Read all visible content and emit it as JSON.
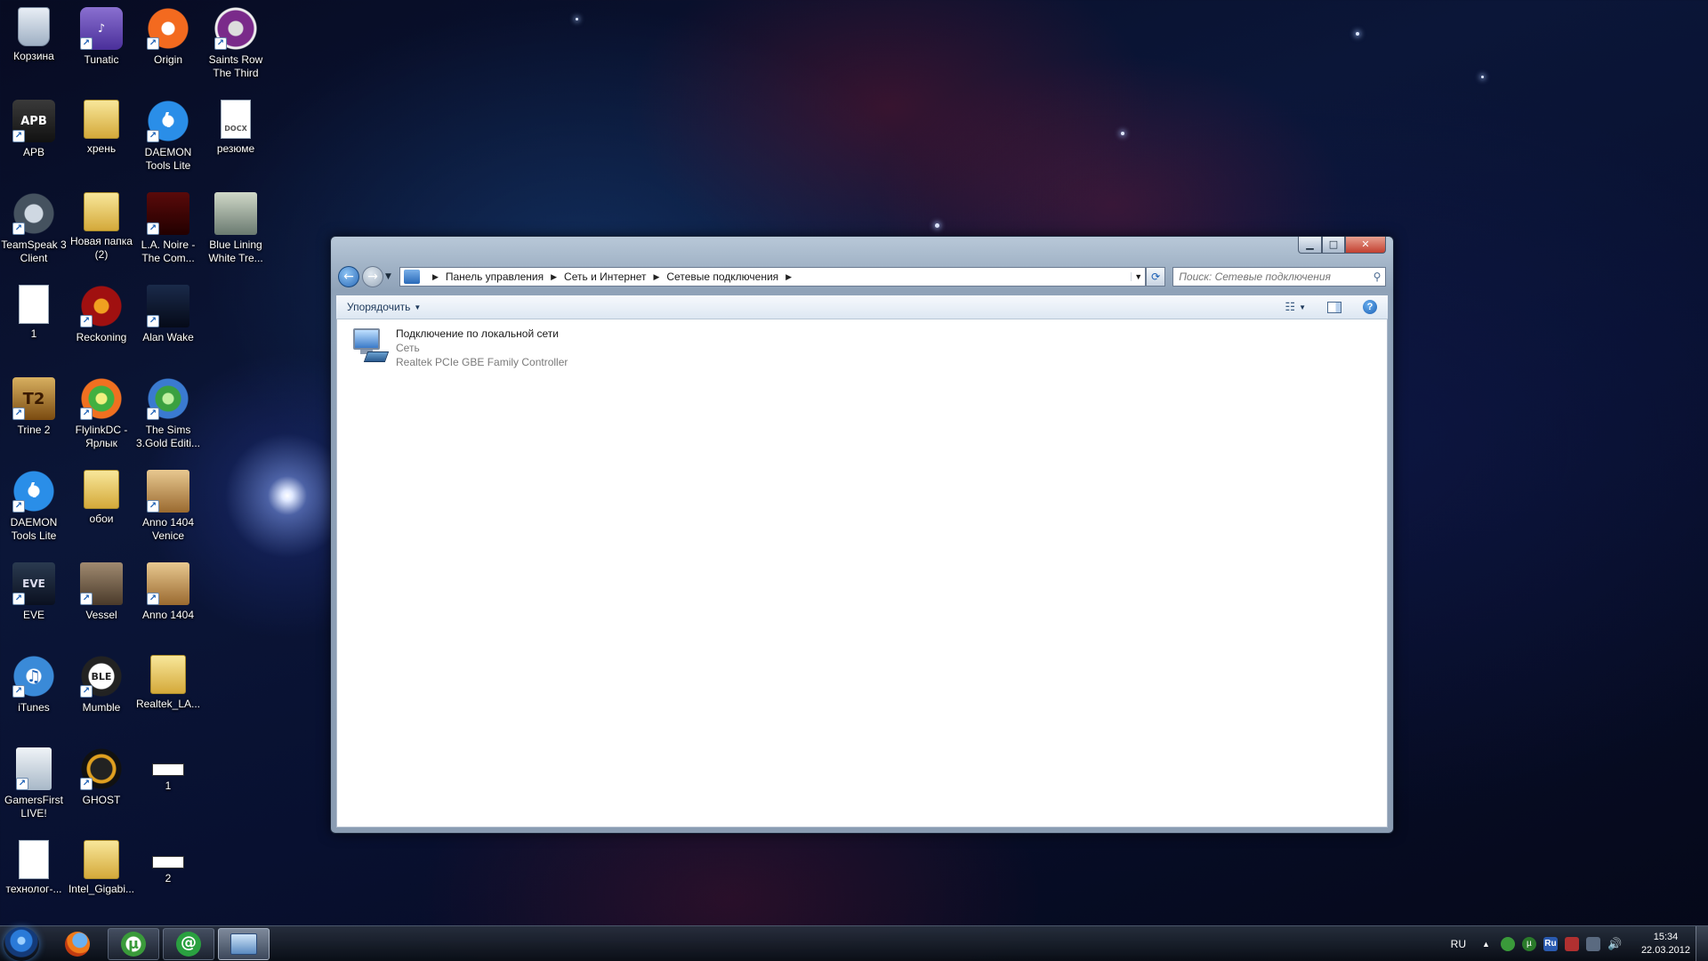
{
  "desktop": {
    "icons": [
      {
        "label": "Корзина",
        "icon": "recycle-bin-icon"
      },
      {
        "label": "Tunatic",
        "icon": "tunatic-icon"
      },
      {
        "label": "Origin",
        "icon": "origin-icon"
      },
      {
        "label": "Saints Row The Third",
        "icon": "saints-row-icon"
      },
      {
        "label": "APB",
        "icon": "apb-icon"
      },
      {
        "label": "хрень",
        "icon": "folder-icon"
      },
      {
        "label": "DAEMON Tools Lite",
        "icon": "daemon-tools-icon"
      },
      {
        "label": "резюме",
        "icon": "docx-file-icon",
        "badge": "DOCX"
      },
      {
        "label": "TeamSpeak 3 Client",
        "icon": "teamspeak-icon"
      },
      {
        "label": "Новая папка (2)",
        "icon": "folder-icon"
      },
      {
        "label": "L.A. Noire - The Com...",
        "icon": "la-noire-icon"
      },
      {
        "label": "Blue Lining White Tre...",
        "icon": "blue-lining-icon"
      },
      {
        "label": "1",
        "icon": "text-file-icon"
      },
      {
        "label": "Reckoning",
        "icon": "reckoning-icon"
      },
      {
        "label": "Alan Wake",
        "icon": "alan-wake-icon"
      },
      {
        "label": "Trine 2",
        "icon": "trine-icon"
      },
      {
        "label": "FlylinkDC - Ярлык",
        "icon": "flylinkdc-icon"
      },
      {
        "label": "The Sims 3.Gold Editi...",
        "icon": "sims-icon"
      },
      {
        "label": "DAEMON Tools Lite",
        "icon": "daemon-tools-icon"
      },
      {
        "label": "обои",
        "icon": "folder-icon"
      },
      {
        "label": "Anno 1404 Venice",
        "icon": "anno-icon"
      },
      {
        "label": "EVE",
        "icon": "eve-icon"
      },
      {
        "label": "Vessel",
        "icon": "vessel-icon"
      },
      {
        "label": "Anno 1404",
        "icon": "anno-icon"
      },
      {
        "label": "iTunes",
        "icon": "itunes-icon"
      },
      {
        "label": "Mumble",
        "icon": "mumble-icon"
      },
      {
        "label": "Realtek_LA...",
        "icon": "folder-icon"
      },
      {
        "label": "GamersFirst LIVE!",
        "icon": "gamersfirst-icon"
      },
      {
        "label": "GHOST",
        "icon": "ghost-icon"
      },
      {
        "label": "1",
        "icon": "shortcut-file-icon"
      },
      {
        "label": "технолог-...",
        "icon": "text-file-icon"
      },
      {
        "label": "Intel_Gigabi...",
        "icon": "folder-icon"
      },
      {
        "label": "2",
        "icon": "shortcut-file-icon"
      }
    ]
  },
  "window": {
    "controls": {
      "minimize": "▁",
      "maximize": "□",
      "close": "✕"
    },
    "breadcrumb": [
      "Панель управления",
      "Сеть и Интернет",
      "Сетевые подключения"
    ],
    "search_placeholder": "Поиск: Сетевые подключения",
    "toolbar": {
      "organize_label": "Упорядочить",
      "help": "?"
    },
    "connection": {
      "name": "Подключение по локальной сети",
      "status": "Сеть",
      "adapter": "Realtek PCIe GBE Family Controller"
    }
  },
  "taskbar": {
    "apps": [
      {
        "name": "firefox",
        "state": "pinned"
      },
      {
        "name": "utorrent",
        "state": "open",
        "glyph": "µ"
      },
      {
        "name": "mail-agent",
        "state": "open",
        "glyph": "@"
      },
      {
        "name": "explorer-network-connections",
        "state": "active"
      }
    ],
    "tray": {
      "language": "RU",
      "ru_badge": "Ru",
      "time": "15:34",
      "date": "22.03.2012"
    }
  },
  "colors": {
    "window_frame": "#8fa2b8",
    "close_button": "#c24030",
    "link_text": "#1e395b",
    "secondary_text": "#7a7a7a"
  }
}
